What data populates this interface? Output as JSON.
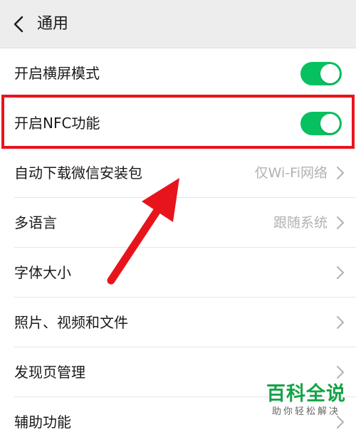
{
  "header": {
    "back_icon": "chevron-left-icon",
    "title": "通用"
  },
  "settings": [
    {
      "label": "开启横屏模式",
      "control": "toggle",
      "on": true
    },
    {
      "label": "开启NFC功能",
      "control": "toggle",
      "on": true
    },
    {
      "label": "自动下载微信安装包",
      "value": "仅Wi-Fi网络",
      "control": "chevron"
    },
    {
      "label": "多语言",
      "value": "跟随系统",
      "control": "chevron"
    },
    {
      "label": "字体大小",
      "control": "chevron"
    },
    {
      "label": "照片、视频和文件",
      "control": "chevron"
    },
    {
      "label": "发现页管理",
      "control": "chevron"
    },
    {
      "label": "辅助功能",
      "control": "chevron"
    }
  ],
  "annotation": {
    "highlight_color": "#e8141c",
    "arrow_color": "#e8141c"
  },
  "colors": {
    "toggle_on": "#07c160",
    "header_bg": "#ededed",
    "secondary_text": "#b2b2b2"
  },
  "watermark": {
    "brand": "百科全说",
    "slogan": "助你轻松解决"
  }
}
